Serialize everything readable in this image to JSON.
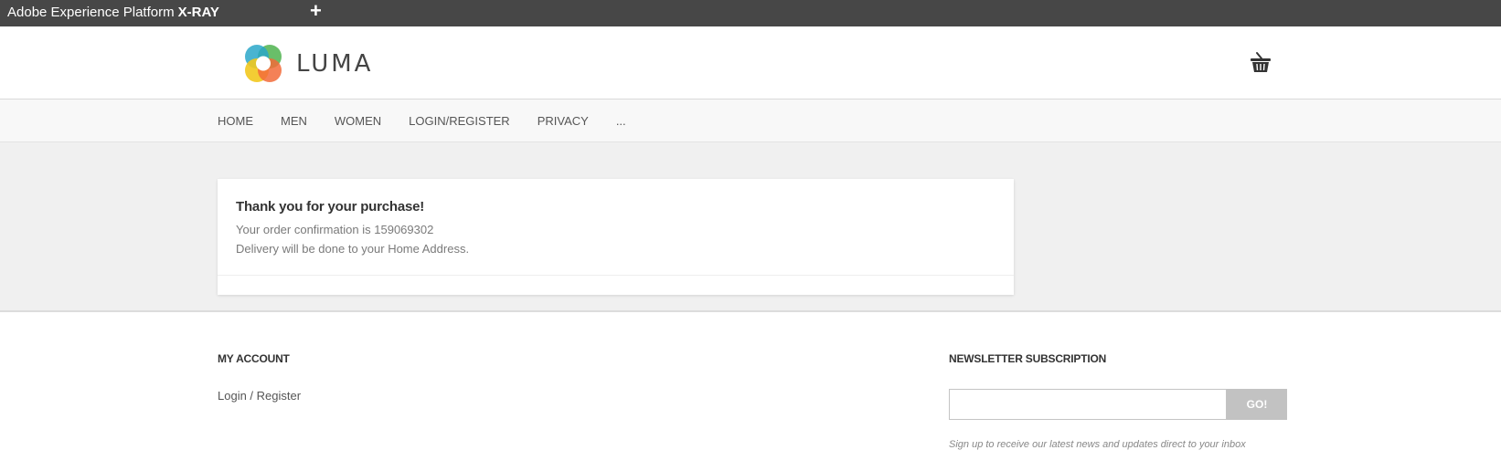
{
  "xray_bar": {
    "brand": "Adobe Experience Platform",
    "product": "X-RAY",
    "add_icon": "plus-icon",
    "add_label": "+"
  },
  "header": {
    "logo_text": "LUMA",
    "logo_icon": "luma-logo-icon",
    "cart_icon": "shopping-basket-icon"
  },
  "nav": {
    "items": [
      {
        "label": "HOME"
      },
      {
        "label": "MEN"
      },
      {
        "label": "WOMEN"
      },
      {
        "label": "LOGIN/REGISTER"
      },
      {
        "label": "PRIVACY"
      },
      {
        "label": "..."
      }
    ]
  },
  "order": {
    "thanks": "Thank you for your purchase!",
    "confirmation": "Your order confirmation is 159069302",
    "delivery": "Delivery will be done to your Home Address."
  },
  "footer": {
    "my_account_heading": "MY ACCOUNT",
    "login_link": "Login / Register",
    "newsletter_heading": "NEWSLETTER SUBSCRIPTION",
    "newsletter_input_value": "",
    "go_label": "GO!",
    "newsletter_note": "Sign up to receive our latest news and updates direct to your inbox"
  },
  "colors": {
    "xray_bar_bg": "#474747",
    "nav_bg": "#f8f8f8",
    "content_bg": "#f0f0f0",
    "go_button_bg": "#c2c2c2",
    "logo_green": "#5cb85c",
    "logo_blue": "#2aa7c9",
    "logo_yellow": "#f2c81e",
    "logo_orange": "#f26b3a"
  }
}
